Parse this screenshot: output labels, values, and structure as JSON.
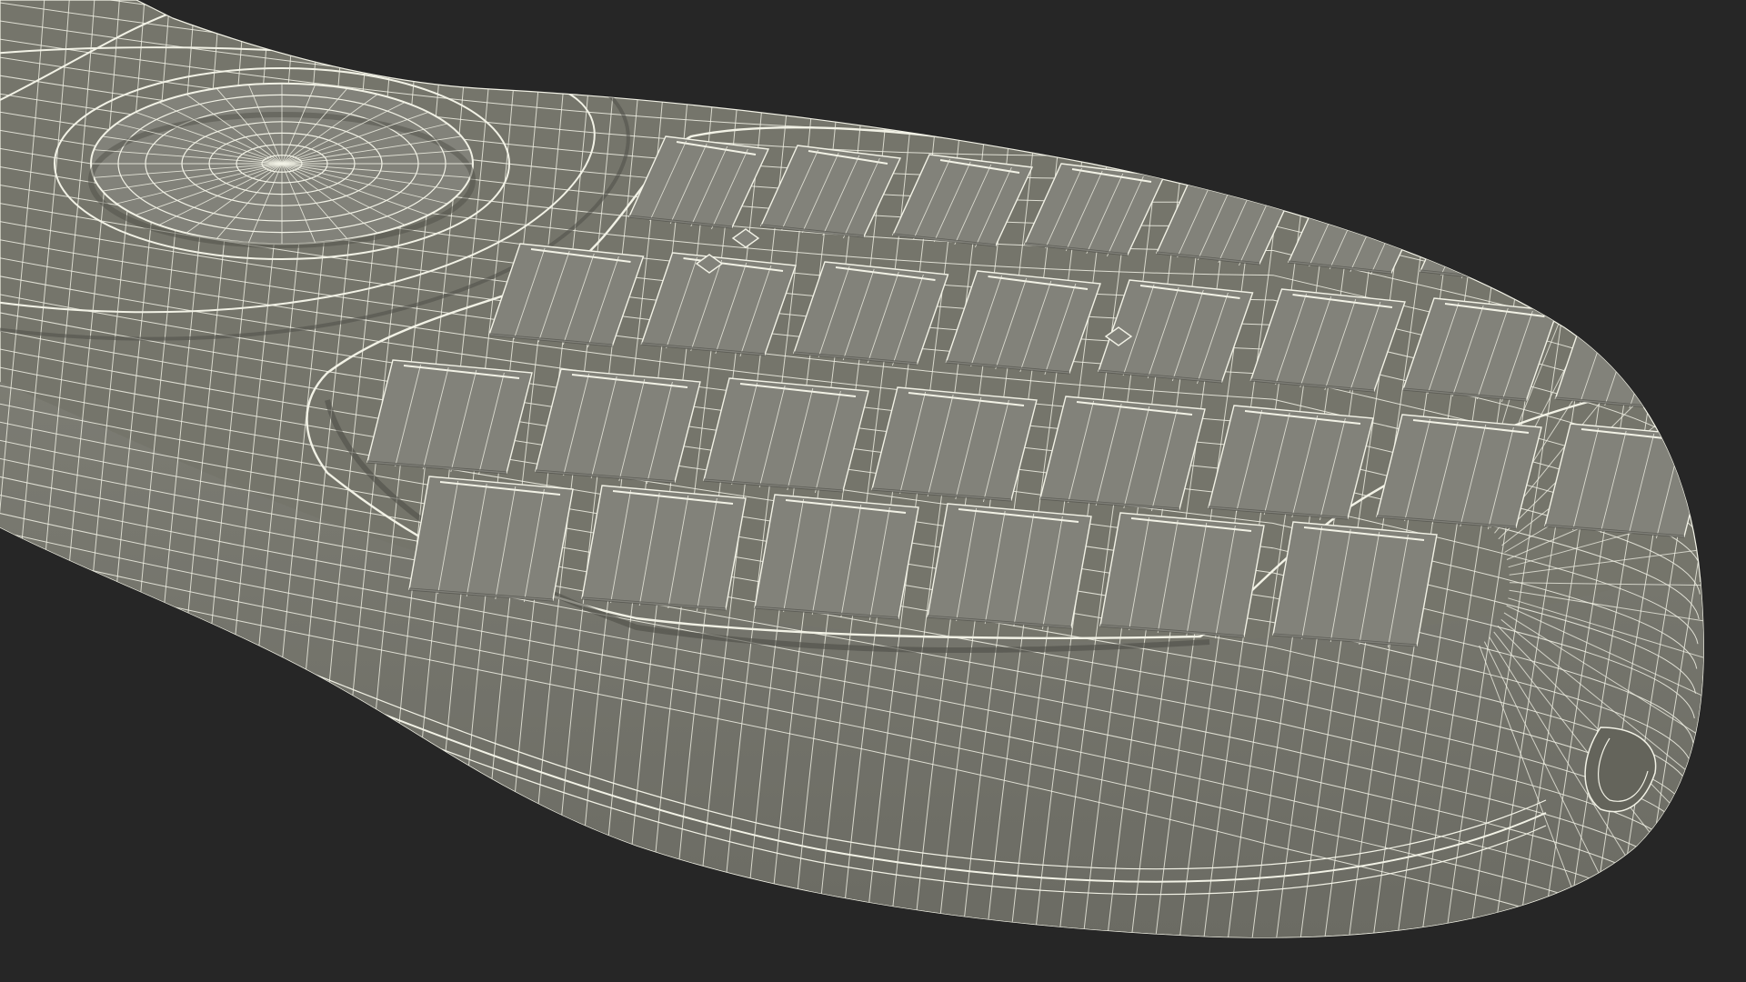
{
  "scene": {
    "subject": "wireframe-remote-control-model",
    "colors": {
      "background": "#262626",
      "surface": "#75756b",
      "surface_dark": "#64645b",
      "surface_light": "#82827a",
      "wire": "#f2f2e6",
      "shadow": "#4f4f48"
    }
  }
}
